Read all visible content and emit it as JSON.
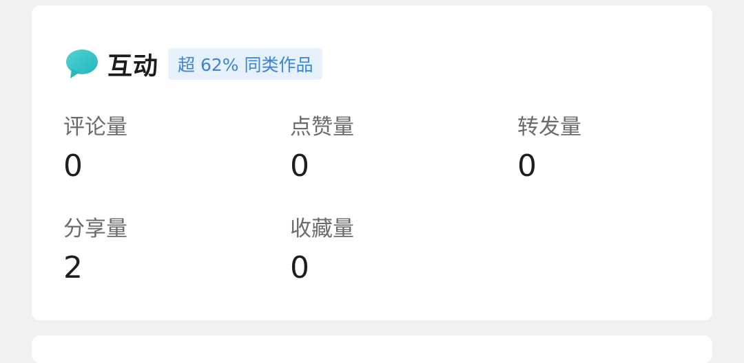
{
  "section": {
    "title": "互动",
    "badge": "超 62% 同类作品",
    "icon": "chat-bubble-icon",
    "accent_color": "#3b84d6",
    "icon_color": "#2ec4c6"
  },
  "stats": [
    {
      "label": "评论量",
      "value": "0"
    },
    {
      "label": "点赞量",
      "value": "0"
    },
    {
      "label": "转发量",
      "value": "0"
    },
    {
      "label": "分享量",
      "value": "2"
    },
    {
      "label": "收藏量",
      "value": "0"
    }
  ]
}
